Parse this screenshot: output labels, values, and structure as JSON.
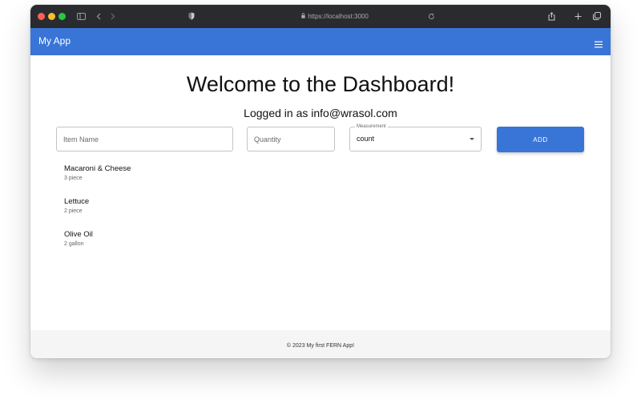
{
  "browser": {
    "url": "https://localhost:3000"
  },
  "app": {
    "title": "My App",
    "accent_color": "#3875d7"
  },
  "main": {
    "heading": "Welcome to the Dashboard!",
    "logged_in_text": "Logged in as info@wrasol.com"
  },
  "form": {
    "item_name_placeholder": "Item Name",
    "quantity_placeholder": "Quantity",
    "measurement_label": "Measurement",
    "measurement_value": "count",
    "add_label": "ADD"
  },
  "items": [
    {
      "name": "Macaroni & Cheese",
      "detail": "3 piece"
    },
    {
      "name": "Lettuce",
      "detail": "2 piece"
    },
    {
      "name": "Olive Oil",
      "detail": "2 gallon"
    }
  ],
  "footer": {
    "text": "© 2023 My first FERN App!"
  },
  "icons": {
    "toolbar": [
      "sidebar-icon",
      "back-icon",
      "forward-icon",
      "shield-icon",
      "lock-icon",
      "reload-icon",
      "share-icon",
      "new-tab-icon",
      "tabs-overview-icon",
      "menu-icon",
      "dropdown-arrow-icon"
    ]
  }
}
